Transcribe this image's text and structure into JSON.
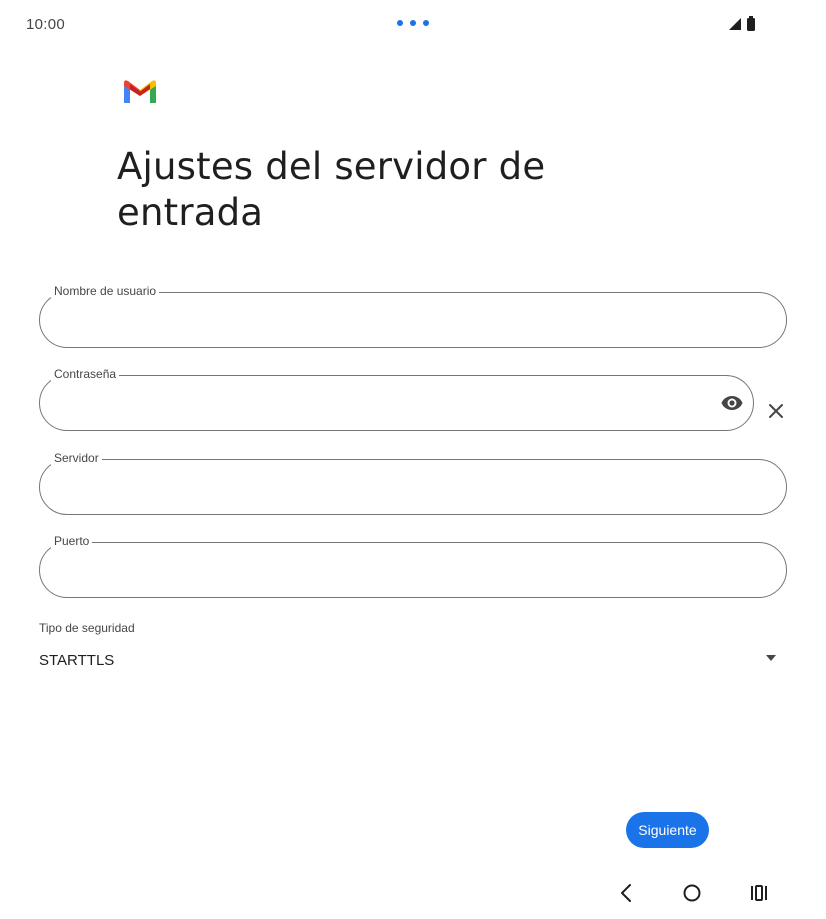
{
  "status_bar": {
    "time": "10:00",
    "icons": [
      "signal-icon",
      "battery-icon"
    ],
    "dots_color": "#1a73e8"
  },
  "app": {
    "logo_icon": "gmail-logo-icon",
    "title": "Ajustes del servidor de entrada"
  },
  "form": {
    "username": {
      "label": "Nombre de usuario",
      "value": ""
    },
    "password": {
      "label": "Contraseña",
      "value": "",
      "toggle_icon": "eye-icon",
      "clear_icon": "close-icon"
    },
    "server": {
      "label": "Servidor",
      "value": ""
    },
    "port": {
      "label": "Puerto",
      "value": ""
    },
    "security": {
      "label": "Tipo de seguridad",
      "selected": "STARTTLS",
      "dropdown_icon": "caret-down-icon"
    }
  },
  "actions": {
    "next_label": "Siguiente"
  },
  "colors": {
    "accent": "#1a73e8",
    "outline": "#747775",
    "text": "#1f1f1f",
    "secondary_text": "#444746"
  },
  "navigation": {
    "icons": [
      "back-icon",
      "home-icon",
      "recents-icon"
    ]
  }
}
